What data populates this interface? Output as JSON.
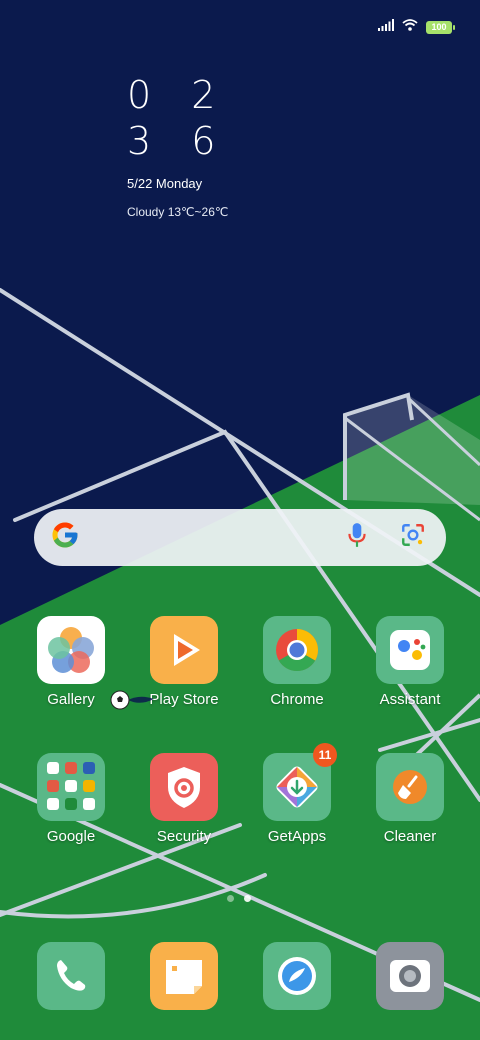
{
  "status_bar": {
    "battery_level": "100",
    "icons": [
      "signal-icon",
      "wifi-icon",
      "battery-icon"
    ]
  },
  "clock": {
    "hours": "0 2",
    "minutes": "3 6",
    "date": "5/22 Monday",
    "weather": "Cloudy 13℃~26℃"
  },
  "search": {
    "icons": [
      "google-g-icon",
      "microphone-icon",
      "google-lens-icon"
    ]
  },
  "apps": [
    {
      "label": "Gallery",
      "icon": "gallery-icon",
      "color": "#ffffff"
    },
    {
      "label": "Play Store",
      "icon": "play-store-icon",
      "color": "#f9b04a"
    },
    {
      "label": "Chrome",
      "icon": "chrome-icon",
      "color": "#5ab888"
    },
    {
      "label": "Assistant",
      "icon": "assistant-icon",
      "color": "#5ab888"
    },
    {
      "label": "Google",
      "icon": "google-folder-icon",
      "color": "#5ab888"
    },
    {
      "label": "Security",
      "icon": "security-shield-icon",
      "color": "#ec5f5a"
    },
    {
      "label": "GetApps",
      "icon": "getapps-icon",
      "color": "#5ab888",
      "badge": "11"
    },
    {
      "label": "Cleaner",
      "icon": "cleaner-broom-icon",
      "color": "#5ab888"
    }
  ],
  "dock": [
    {
      "name": "phone",
      "icon": "phone-icon",
      "color": "#5ab888"
    },
    {
      "name": "messages",
      "icon": "messages-icon",
      "color": "#f9b04a"
    },
    {
      "name": "browser",
      "icon": "browser-icon",
      "color": "#5ab888"
    },
    {
      "name": "camera",
      "icon": "camera-icon",
      "color": "#8d939c"
    }
  ],
  "page_indicator": {
    "pages": 2,
    "current": 2
  }
}
